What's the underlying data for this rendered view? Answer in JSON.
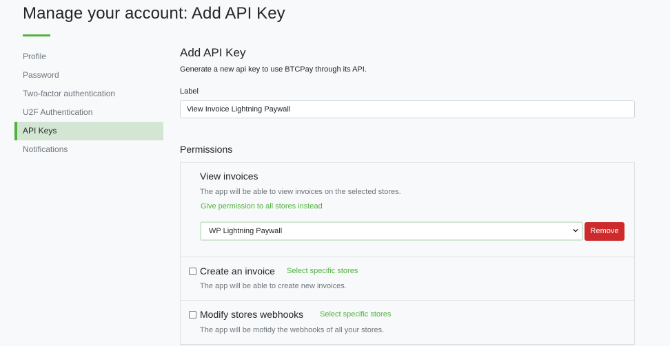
{
  "page": {
    "title": "Manage your account: Add API Key"
  },
  "sidebar": {
    "items": [
      {
        "label": "Profile"
      },
      {
        "label": "Password"
      },
      {
        "label": "Two-factor authentication"
      },
      {
        "label": "U2F Authentication"
      },
      {
        "label": "API Keys",
        "active": true
      },
      {
        "label": "Notifications"
      }
    ]
  },
  "main": {
    "heading": "Add API Key",
    "description": "Generate a new api key to use BTCPay through its API.",
    "label_field": {
      "label": "Label",
      "value": "View Invoice Lightning Paywall"
    }
  },
  "permissions": {
    "heading": "Permissions",
    "view_invoices": {
      "name": "View invoices",
      "description": "The app will be able to view invoices on the selected stores.",
      "link": "Give permission to all stores instead",
      "selected_store": "WP Lightning Paywall",
      "remove_label": "Remove"
    },
    "create_invoice": {
      "name": "Create an invoice",
      "link": "Select specific stores",
      "description": "The app will be able to create new invoices."
    },
    "modify_webhooks": {
      "name": "Modify stores webhooks",
      "link": "Select specific stores",
      "description": "The app will be mofidy the webhooks of all your stores."
    }
  },
  "colors": {
    "accent": "#51b13e",
    "active_bg": "#d3e6d3",
    "danger": "#cd2b2b"
  }
}
